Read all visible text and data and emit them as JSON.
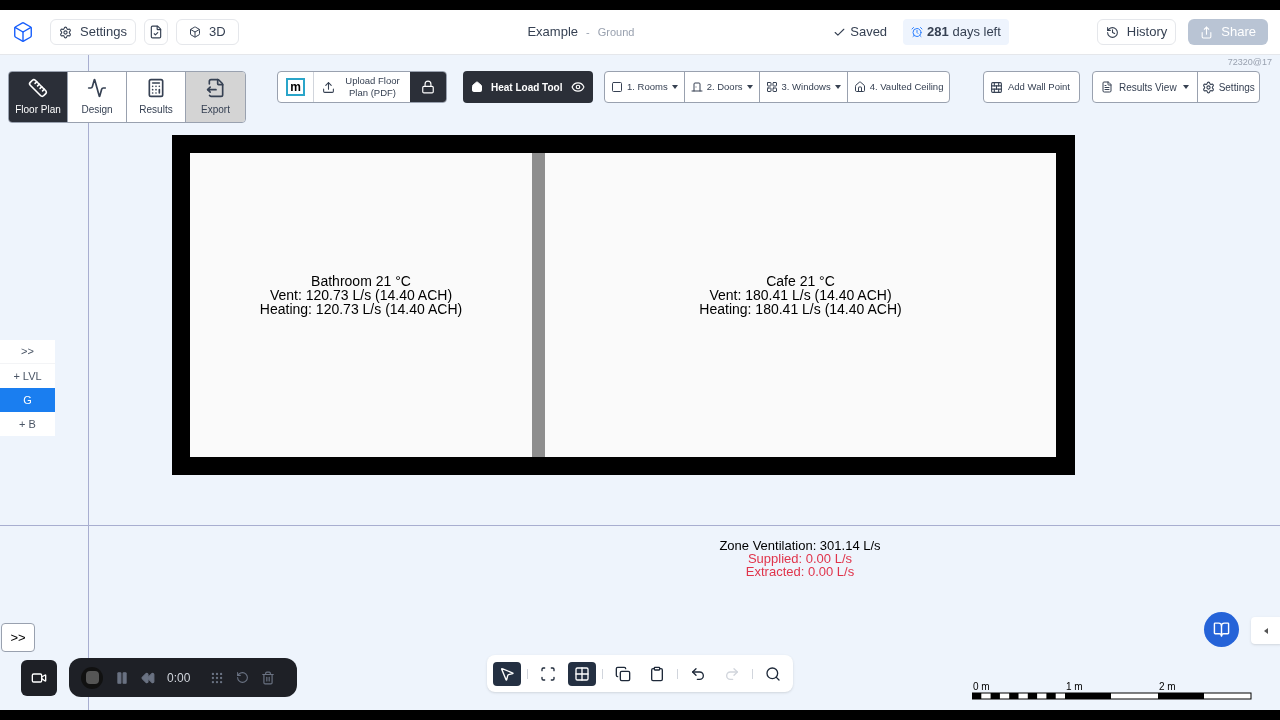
{
  "header": {
    "settings": "Settings",
    "view_3d": "3D",
    "title": "Example",
    "separator": "-",
    "subtitle": "Ground",
    "saved": "Saved",
    "trial": "**281** days left",
    "history": "History",
    "share": {
      "label": "Share",
      "disabled": true
    }
  },
  "build_id": "72320@17",
  "modes": [
    {
      "kind": "floor",
      "label": "Floor Plan",
      "selected": true,
      "hovered": false
    },
    {
      "kind": "design",
      "label": "Design",
      "selected": false,
      "hovered": false
    },
    {
      "kind": "results",
      "label": "Results",
      "selected": false,
      "hovered": false
    },
    {
      "kind": "export",
      "label": "Export",
      "selected": false,
      "hovered": true
    }
  ],
  "upload": {
    "logo": "m",
    "label": "Upload Floor Plan (PDF)",
    "locked": true
  },
  "heat_load": {
    "label": "Heat Load Tool",
    "visible": true
  },
  "steps": [
    {
      "kind": "rooms",
      "label": "1. Rooms",
      "dropdown": true
    },
    {
      "kind": "doors",
      "label": "2. Doors",
      "dropdown": true
    },
    {
      "kind": "windows",
      "label": "3. Windows",
      "dropdown": true
    },
    {
      "kind": "ceiling",
      "label": "4. Vaulted Ceiling",
      "dropdown": false
    }
  ],
  "add_wall_point": "Add Wall Point",
  "results_view": {
    "label": "Results View",
    "dropdown": true
  },
  "view_settings": "Settings",
  "rooms": [
    {
      "lines": [
        "Bathroom 21 °C",
        "Vent: 120.73 L/s (14.40  ACH)",
        "Heating: 120.73 L/s (14.40  ACH)"
      ]
    },
    {
      "lines": [
        "Cafe 21 °C",
        "Vent: 180.41 L/s (14.40  ACH)",
        "Heating: 180.41 L/s (14.40  ACH)"
      ]
    }
  ],
  "zone": [
    {
      "kind": "total",
      "text": "Zone Ventilation: 301.14 L/s"
    },
    {
      "kind": "warning",
      "text": "Supplied: 0.00 L/s"
    },
    {
      "kind": "warning",
      "text": "Extracted: 0.00 L/s"
    }
  ],
  "levels": {
    "expand": ">>",
    "items": [
      {
        "label": "+ LVL",
        "selected": false
      },
      {
        "label": "G",
        "selected": true
      },
      {
        "label": "+ B",
        "selected": false
      }
    ]
  },
  "panel_toggle": ">>",
  "recorder": {
    "time": "0:00"
  },
  "tools": [
    {
      "kind": "select",
      "selected": true,
      "disabled": false
    },
    {
      "kind": "fit",
      "selected": false,
      "disabled": false
    },
    {
      "kind": "grid",
      "selected": true,
      "disabled": false
    },
    {
      "kind": "copy",
      "selected": false,
      "disabled": false
    },
    {
      "kind": "paste",
      "selected": false,
      "disabled": false
    },
    {
      "kind": "undo",
      "selected": false,
      "disabled": false
    },
    {
      "kind": "redo",
      "selected": false,
      "disabled": true
    },
    {
      "kind": "search",
      "selected": false,
      "disabled": false
    }
  ],
  "scale": [
    "0 m",
    "1 m",
    "2 m"
  ]
}
